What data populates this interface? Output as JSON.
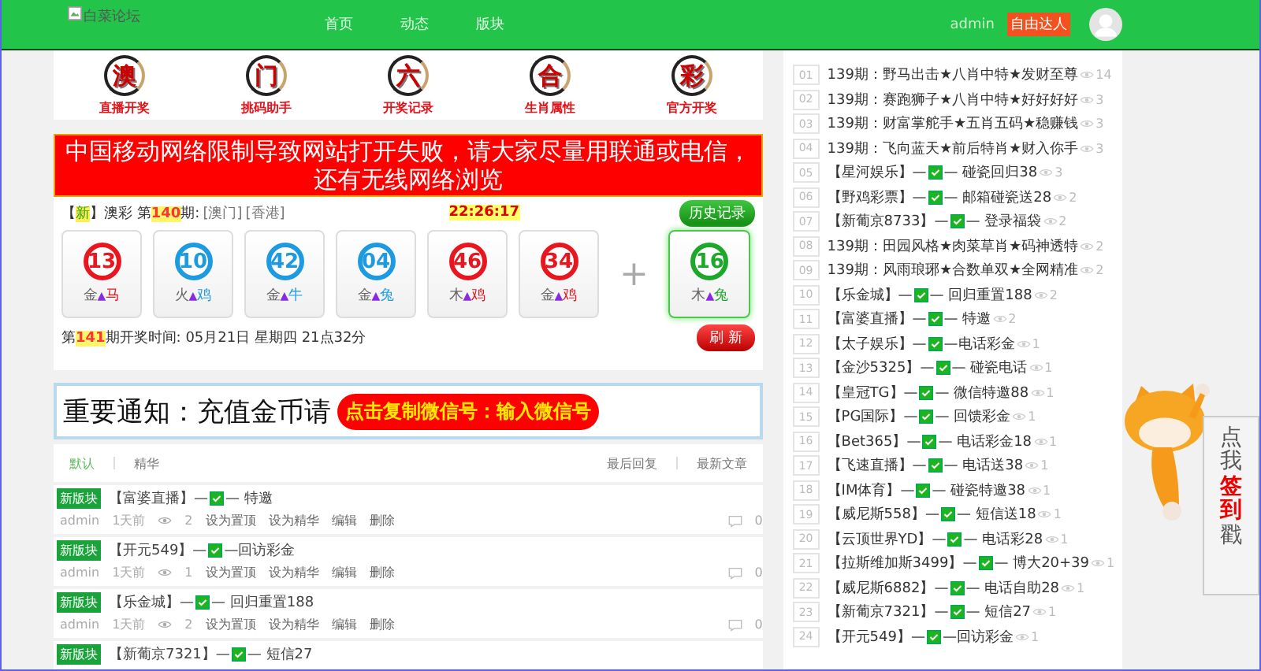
{
  "header": {
    "logo_alt": "白菜论坛",
    "nav": [
      {
        "label": "首页"
      },
      {
        "label": "动态"
      },
      {
        "label": "版块"
      }
    ],
    "user": "admin",
    "user_badge": "自由达人"
  },
  "nav_icons": [
    {
      "glyph": "澳",
      "label": "直播开奖"
    },
    {
      "glyph": "门",
      "label": "挑码助手"
    },
    {
      "glyph": "六",
      "label": "开奖记录"
    },
    {
      "glyph": "合",
      "label": "生肖属性"
    },
    {
      "glyph": "彩",
      "label": "官方开奖"
    }
  ],
  "alert": "中国移动网络限制导致网站打开失败，请大家尽量用联通或电信，还有无线网络浏览",
  "lottery": {
    "tag_open": "【",
    "tag": "新",
    "tag_close": "】",
    "name": "澳彩",
    "period_prefix": "第",
    "period": "140",
    "period_suffix": "期:",
    "links": [
      "[澳门]",
      "[香港]"
    ],
    "clock": "22:26:17",
    "history_button": "历史记录",
    "balls": [
      {
        "number": "13",
        "element": "金",
        "mark": "▲",
        "zodiac": "马",
        "color": "#e8171f",
        "special": false
      },
      {
        "number": "10",
        "element": "火",
        "mark": "▲",
        "zodiac": "鸡",
        "color": "#1e9be0",
        "special": false
      },
      {
        "number": "42",
        "element": "金",
        "mark": "▲",
        "zodiac": "牛",
        "color": "#1e9be0",
        "special": false
      },
      {
        "number": "04",
        "element": "金",
        "mark": "▲",
        "zodiac": "兔",
        "color": "#1e9be0",
        "special": false
      },
      {
        "number": "46",
        "element": "木",
        "mark": "▲",
        "zodiac": "鸡",
        "color": "#e8171f",
        "special": false
      },
      {
        "number": "34",
        "element": "金",
        "mark": "▲",
        "zodiac": "鸡",
        "color": "#e8171f",
        "special": false
      },
      {
        "number": "16",
        "element": "木",
        "mark": "▲",
        "zodiac": "兔",
        "color": "#1ea82b",
        "special": true
      }
    ],
    "plus": "+",
    "next_prefix": "第",
    "next_period": "141",
    "next_text": "期开奖时间: 05月21日 星期四 21点32分",
    "refresh_button": "刷 新"
  },
  "notice": {
    "text": "重要通知：充值金币请",
    "button": "点击复制微信号：输入微信号"
  },
  "tabs": [
    {
      "label": "默认",
      "selected": true
    },
    {
      "label": "精华",
      "selected": false
    }
  ],
  "sort_links": [
    "最后回复",
    "最新文章"
  ],
  "posts": [
    {
      "tag": "新版块",
      "before": "【富婆直播】—",
      "after": "— 特邀",
      "author": "admin",
      "time": "1天前",
      "views": "2",
      "actions": [
        "设为置顶",
        "设为精华",
        "编辑",
        "删除"
      ],
      "comments": "0"
    },
    {
      "tag": "新版块",
      "before": "【开元549】—",
      "after": "—回访彩金",
      "author": "admin",
      "time": "1天前",
      "views": "1",
      "actions": [
        "设为置顶",
        "设为精华",
        "编辑",
        "删除"
      ],
      "comments": "0"
    },
    {
      "tag": "新版块",
      "before": "【乐金城】—",
      "after": "— 回归重置188",
      "author": "admin",
      "time": "1天前",
      "views": "2",
      "actions": [
        "设为置顶",
        "设为精华",
        "编辑",
        "删除"
      ],
      "comments": "0"
    },
    {
      "tag": "新版块",
      "before": "【新葡京7321】—",
      "after": "— 短信27"
    }
  ],
  "sidebar": [
    {
      "num": "01",
      "kind": "text",
      "text": "139期：野马出击★八肖中特★发财至尊",
      "views": "14"
    },
    {
      "num": "02",
      "kind": "text",
      "text": "139期：赛跑狮子★八肖中特★好好好好",
      "views": "3"
    },
    {
      "num": "03",
      "kind": "text",
      "text": "139期：财富掌舵手★五肖五码★稳赚钱",
      "views": "3"
    },
    {
      "num": "04",
      "kind": "text",
      "text": "139期：飞向蓝天★前后特肖★财入你手",
      "views": "3"
    },
    {
      "num": "05",
      "kind": "promo",
      "before": "【星河娱乐】—",
      "after": "— 碰瓷回归38",
      "views": "3"
    },
    {
      "num": "06",
      "kind": "promo",
      "before": "【野鸡彩票】—",
      "after": "— 邮箱碰瓷送28",
      "views": "2"
    },
    {
      "num": "07",
      "kind": "promo",
      "before": "【新葡京8733】—",
      "after": "— 登录福袋",
      "views": "2"
    },
    {
      "num": "08",
      "kind": "text",
      "text": "139期：田园风格★肉菜草肖★码神透特",
      "views": "2"
    },
    {
      "num": "09",
      "kind": "text",
      "text": "139期：风雨琅琊★合数单双★全网精准",
      "views": "2"
    },
    {
      "num": "10",
      "kind": "promo",
      "before": "【乐金城】—",
      "after": "— 回归重置188",
      "views": "2"
    },
    {
      "num": "11",
      "kind": "promo",
      "before": "【富婆直播】—",
      "after": "— 特邀",
      "views": "2"
    },
    {
      "num": "12",
      "kind": "promo",
      "before": "【太子娱乐】—",
      "after": "—电话彩金",
      "views": "1"
    },
    {
      "num": "13",
      "kind": "promo",
      "before": "【金沙5325】—",
      "after": "— 碰瓷电话",
      "views": "1"
    },
    {
      "num": "14",
      "kind": "promo",
      "before": "【皇冠TG】—",
      "after": "— 微信特邀88",
      "views": "1"
    },
    {
      "num": "15",
      "kind": "promo",
      "before": "【PG国际】—",
      "after": "— 回馈彩金",
      "views": "1"
    },
    {
      "num": "16",
      "kind": "promo",
      "before": "【Bet365】—",
      "after": "— 电话彩金18",
      "views": "1"
    },
    {
      "num": "17",
      "kind": "promo",
      "before": "【飞速直播】—",
      "after": "— 电话送38",
      "views": "1"
    },
    {
      "num": "18",
      "kind": "promo",
      "before": "【IM体育】—",
      "after": "— 碰瓷特邀38",
      "views": "1"
    },
    {
      "num": "19",
      "kind": "promo",
      "before": "【威尼斯558】—",
      "after": "— 短信送18",
      "views": "1"
    },
    {
      "num": "20",
      "kind": "promo",
      "before": "【云顶世界YD】—",
      "after": "— 电话彩28",
      "views": "1"
    },
    {
      "num": "21",
      "kind": "promo",
      "before": "【拉斯维加斯3499】—",
      "after": "— 博大20+39",
      "views": "1"
    },
    {
      "num": "22",
      "kind": "promo",
      "before": "【威尼斯6882】—",
      "after": "— 电话自助28",
      "views": "1"
    },
    {
      "num": "23",
      "kind": "promo",
      "before": "【新葡京7321】—",
      "after": "— 短信27",
      "views": "1"
    },
    {
      "num": "24",
      "kind": "promo",
      "before": "【开元549】—",
      "after": "—回访彩金",
      "views": "1"
    }
  ],
  "signin": [
    {
      "text": "点我",
      "highlight": false
    },
    {
      "text": "签到",
      "highlight": true
    },
    {
      "text": "戳",
      "highlight": false
    }
  ]
}
